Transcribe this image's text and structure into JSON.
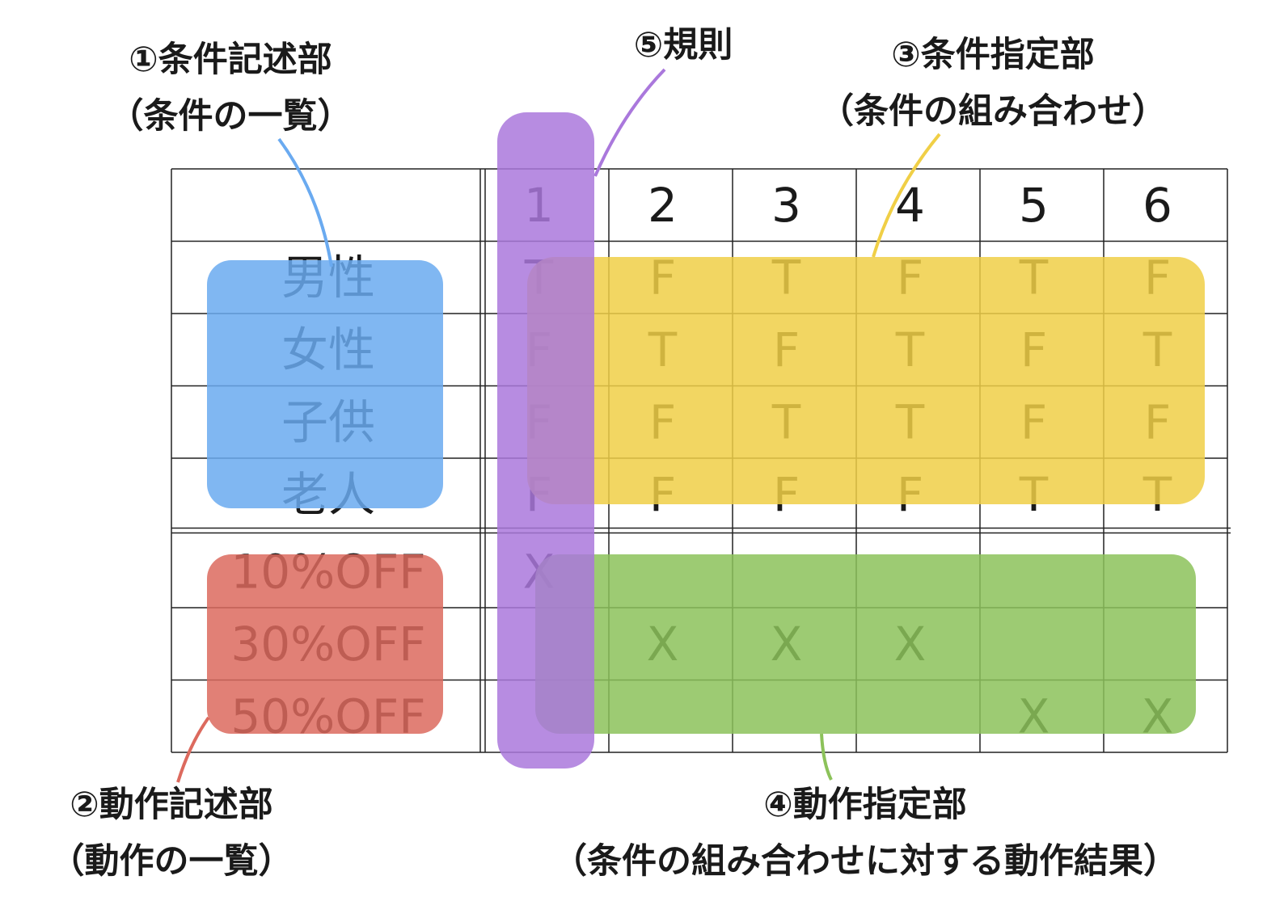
{
  "labels": {
    "condition_stub": {
      "title": "①条件記述部",
      "subtitle": "（条件の一覧）"
    },
    "action_stub": {
      "title": "②動作記述部",
      "subtitle": "（動作の一覧）"
    },
    "condition_entry": {
      "title": "③条件指定部",
      "subtitle": "（条件の組み合わせ）"
    },
    "action_entry": {
      "title": "④動作指定部",
      "subtitle": "（条件の組み合わせに対する動作結果）"
    },
    "rule": {
      "title": "⑤規則"
    }
  },
  "table": {
    "rules": [
      "1",
      "2",
      "3",
      "4",
      "5",
      "6"
    ],
    "conditions": [
      {
        "label": "男性",
        "entries": [
          "T",
          "F",
          "T",
          "F",
          "T",
          "F"
        ]
      },
      {
        "label": "女性",
        "entries": [
          "F",
          "T",
          "F",
          "T",
          "F",
          "T"
        ]
      },
      {
        "label": "子供",
        "entries": [
          "F",
          "F",
          "T",
          "T",
          "F",
          "F"
        ]
      },
      {
        "label": "老人",
        "entries": [
          "F",
          "F",
          "F",
          "F",
          "T",
          "T"
        ]
      }
    ],
    "actions": [
      {
        "label": "10%OFF",
        "entries": [
          "X",
          "",
          "",
          "",
          "",
          ""
        ]
      },
      {
        "label": "30%OFF",
        "entries": [
          "",
          "X",
          "X",
          "X",
          "",
          ""
        ]
      },
      {
        "label": "50%OFF",
        "entries": [
          "",
          "",
          "",
          "",
          "X",
          "X"
        ]
      }
    ]
  },
  "colors": {
    "condition_stub": "#6aaaf0",
    "action_stub": "#dc6a5e",
    "condition_entry": "#f0cf46",
    "action_entry": "#8cc25a",
    "rule": "#aa78dc"
  }
}
